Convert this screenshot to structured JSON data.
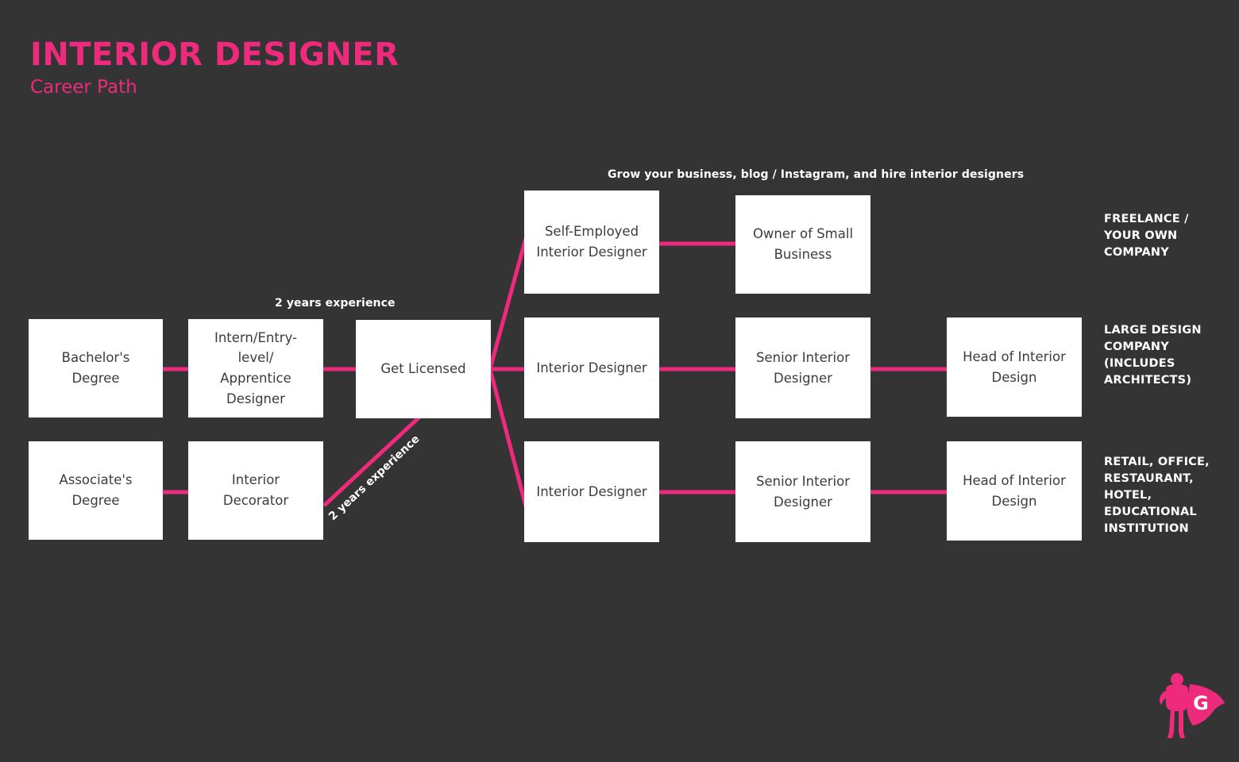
{
  "header": {
    "title": "INTERIOR DESIGNER",
    "subtitle": "Career Path"
  },
  "colors": {
    "background": "#343435",
    "accent_pink": "#ED2A7B",
    "node_fill": "#FFFFFF",
    "node_text": "#3C3C3C",
    "annotation_text": "#FFFFFF"
  },
  "annotations": {
    "grow_business": "Grow your business, blog / Instagram, and hire interior designers",
    "two_years_top": "2 years experience",
    "two_years_diagonal": "2 years experience"
  },
  "nodes": {
    "bachelors_degree": "Bachelor's Degree",
    "intern_entry_level": "Intern/Entry-level/\nApprentice\nDesigner",
    "get_licensed": "Get Licensed",
    "self_employed": "Self-Employed\nInterior Designer",
    "owner_small_business": "Owner of Small\nBusiness",
    "interior_designer_mid": "Interior Designer",
    "senior_interior_designer_mid": "Senior Interior\nDesigner",
    "head_of_interior_design_mid": "Head of Interior\nDesign",
    "associates_degree": "Associate's Degree",
    "interior_decorator": "Interior Decorator",
    "interior_designer_bottom": "Interior Designer",
    "senior_interior_designer_bottom": "Senior Interior\nDesigner",
    "head_of_interior_design_bottom": "Head of Interior\nDesign"
  },
  "categories": {
    "freelance": "FREELANCE /\nYOUR OWN\nCOMPANY",
    "large_design_company": "LARGE DESIGN\nCOMPANY\n(INCLUDES\nARCHITECTS)",
    "retail_office": "RETAIL, OFFICE,\nRESTAURANT,\nHOTEL,\nEDUCATIONAL\nINSTITUTION"
  },
  "logo": {
    "letter": "G",
    "name": "superhero-logo"
  }
}
